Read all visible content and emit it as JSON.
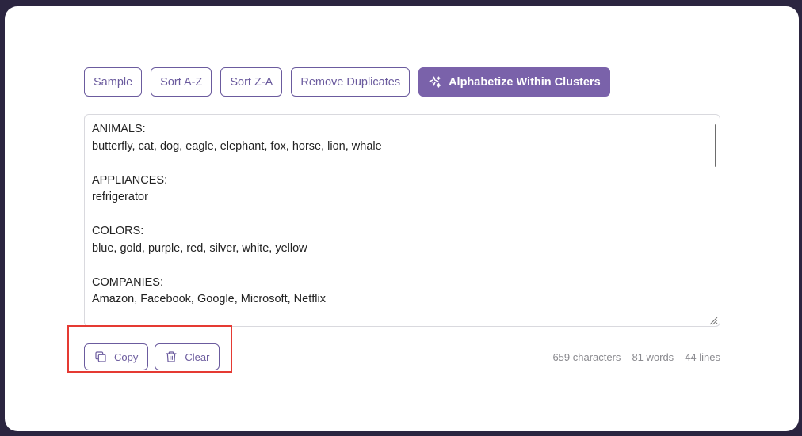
{
  "toolbar": {
    "buttons": [
      {
        "label": "Sample"
      },
      {
        "label": "Sort A-Z"
      },
      {
        "label": "Sort Z-A"
      },
      {
        "label": "Remove Duplicates"
      },
      {
        "label": "Alphabetize Within Clusters",
        "icon": "sparkles-icon"
      }
    ]
  },
  "editor": {
    "text": "ANIMALS:\nbutterfly, cat, dog, eagle, elephant, fox, horse, lion, whale\n\nAPPLIANCES:\nrefrigerator\n\nCOLORS:\nblue, gold, purple, red, silver, white, yellow\n\nCOMPANIES:\nAmazon, Facebook, Google, Microsoft, Netflix\n\nCOUNTRIES:\nAustralia, Brazil, Canada, China, France, Germany, India, Japan"
  },
  "actions": {
    "copy_label": "Copy",
    "clear_label": "Clear"
  },
  "stats": {
    "characters": "659 characters",
    "words": "81 words",
    "lines": "44 lines"
  },
  "colors": {
    "accent": "#7a62aa",
    "outline": "#6b5b9e",
    "highlight": "#e53a33",
    "background": "#2b2540"
  }
}
